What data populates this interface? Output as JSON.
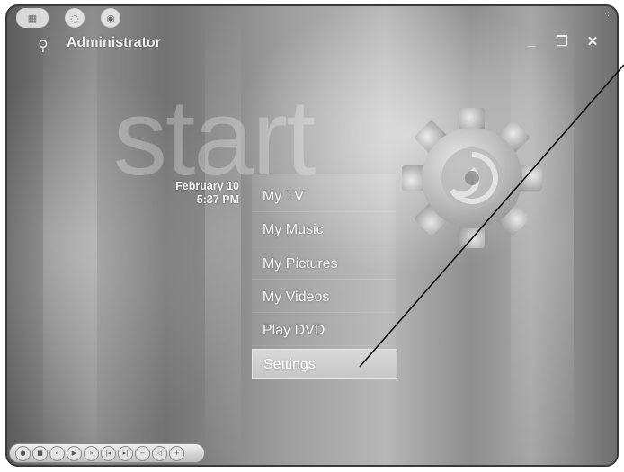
{
  "header": {
    "user_name": "Administrator",
    "icons": [
      "user-icon",
      "minimize-icon",
      "restore-icon",
      "close-icon"
    ],
    "minimize_glyph": "_",
    "restore_glyph": "❐",
    "close_glyph": "✕"
  },
  "background": {
    "watermark": "start"
  },
  "clock": {
    "date": "February 10",
    "time": "5:37 PM"
  },
  "menu": {
    "items": [
      {
        "label": "My TV"
      },
      {
        "label": "My Music"
      },
      {
        "label": "My Pictures"
      },
      {
        "label": "My Videos"
      },
      {
        "label": "Play DVD"
      },
      {
        "label": "Settings",
        "selected": true
      }
    ]
  },
  "colors": {
    "menu_text": "#f5f5f5",
    "selected_bg": "#cfcfcf",
    "frame": "#3a3a3a"
  }
}
